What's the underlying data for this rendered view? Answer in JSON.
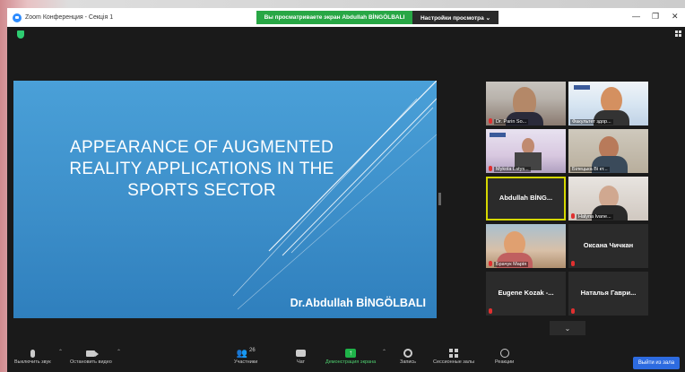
{
  "window": {
    "title": "Zoom Конференция - Секція 1",
    "share_banner": "Вы просматриваете экран Abdullah BİNGÖLBALI",
    "view_options": "Настройки просмотра ⌄",
    "controls": [
      "—",
      "❐",
      "✕"
    ]
  },
  "slide": {
    "title_lines": [
      "APPEARANCE OF AUGMENTED",
      "REALITY APPLICATIONS IN THE",
      "SPORTS SECTOR"
    ],
    "author": "Dr.Abdullah BİNGÖLBALI"
  },
  "participants": [
    {
      "name": "Dr. Parin So...",
      "video": true,
      "muted": true
    },
    {
      "name": "Факультет здор...",
      "video": true,
      "muted": false
    },
    {
      "name": "Mykola Latys...",
      "video": true,
      "muted": true
    },
    {
      "name": "Білецька Ві кт...",
      "video": true,
      "muted": false
    },
    {
      "name": "Abdullah BİNG...",
      "video": false,
      "muted": false,
      "active": true
    },
    {
      "name": "Halyna Ivane...",
      "video": true,
      "muted": true
    },
    {
      "name": "Брачук Марія",
      "video": true,
      "muted": true
    },
    {
      "name": "Оксана Чичкан",
      "video": false,
      "muted": true
    },
    {
      "name": "Eugene Kozak -...",
      "video": false,
      "muted": true
    },
    {
      "name": "Наталья Гаври...",
      "video": false,
      "muted": true
    }
  ],
  "gallery_toggle": "",
  "toolbar": {
    "mute": "Выключить звук",
    "stop_video": "Остановить видео",
    "participants": "Участники",
    "participants_count": "26",
    "chat": "Чат",
    "share": "Демонстрация экрана",
    "record": "Запись",
    "rooms": "Сессионные залы",
    "reactions": "Реакции",
    "leave": "Выйти из зала"
  },
  "colors": {
    "share_green": "#28a745",
    "active_outline": "#d5d800",
    "leave_blue": "#2d6be0",
    "muted_red": "#e03030"
  }
}
